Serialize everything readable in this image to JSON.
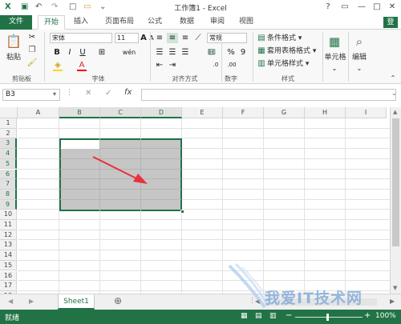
{
  "title": "工作簿1 - Excel",
  "window_controls": [
    "?",
    "▭",
    "—",
    "□",
    "✕"
  ],
  "quick_access": [
    "save-icon",
    "undo-icon",
    "redo-icon",
    "new-file-icon",
    "open-icon",
    "customize-icon"
  ],
  "tabs": [
    {
      "label": "文件"
    },
    {
      "label": "开始"
    },
    {
      "label": "插入"
    },
    {
      "label": "页面布局"
    },
    {
      "label": "公式"
    },
    {
      "label": "数据"
    },
    {
      "label": "审阅"
    },
    {
      "label": "视图"
    }
  ],
  "active_tab": "开始",
  "user_badge": "登",
  "ribbon": {
    "clipboard": {
      "paste": "粘贴",
      "label": "剪贴板"
    },
    "font": {
      "name": "宋体",
      "size": "11",
      "label": "字体",
      "bold": "B",
      "italic": "I",
      "underline": "U",
      "grow": "A",
      "shrink": "A",
      "color": "A",
      "wen": "wén"
    },
    "alignment": {
      "label": "对齐方式"
    },
    "number": {
      "format": "常规",
      "percent": "%",
      "comma": "9",
      "label": "数字"
    },
    "styles": {
      "conditional": "条件格式 ▾",
      "table": "套用表格格式 ▾",
      "cell": "单元格样式 ▾",
      "label": "样式"
    },
    "cells": {
      "label": "单元格"
    },
    "editing": {
      "label": "编辑"
    }
  },
  "formula_bar": {
    "name_box": "B3",
    "cancel": "✕",
    "enter": "✓",
    "fx": "fx",
    "value": ""
  },
  "columns": [
    "A",
    "B",
    "C",
    "D",
    "E",
    "F",
    "G",
    "H",
    "I"
  ],
  "rows": [
    "1",
    "2",
    "3",
    "4",
    "5",
    "6",
    "7",
    "8",
    "9",
    "10",
    "11",
    "12",
    "13",
    "14",
    "15",
    "16",
    "17",
    "18"
  ],
  "selection": {
    "range": "B3:D9",
    "active_cell": "B3"
  },
  "sheets": [
    {
      "label": "Sheet1"
    }
  ],
  "add_sheet": "⊕",
  "status": {
    "ready": "就绪",
    "zoom": "100%"
  },
  "watermark": "我爱IT技术网",
  "colors": {
    "accent": "#217346",
    "selection_fill": "#c6c6c6",
    "arrow": "#e8323c"
  }
}
